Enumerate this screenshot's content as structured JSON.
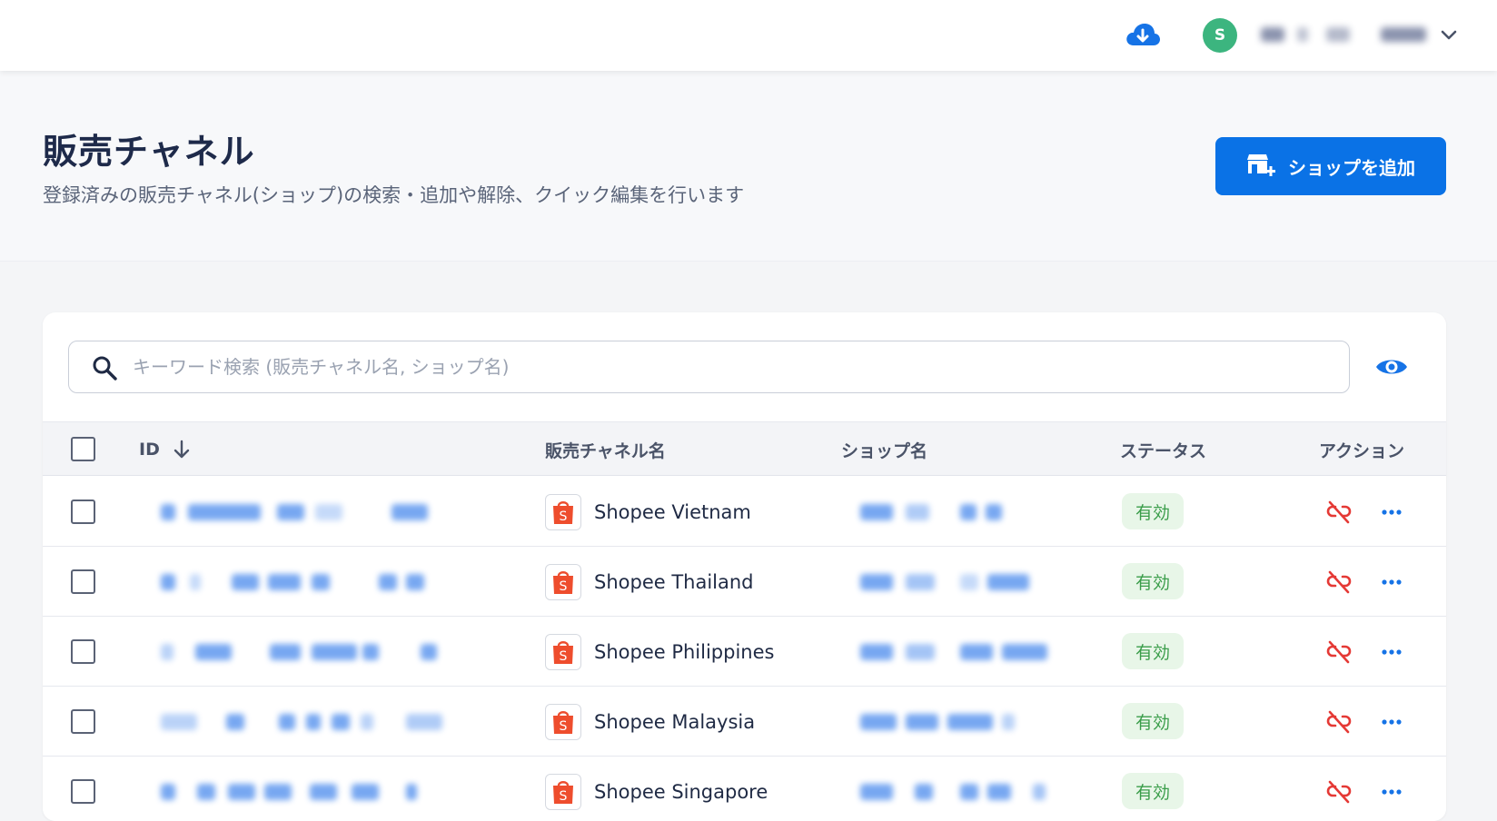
{
  "topbar": {
    "avatar_initial": "S"
  },
  "header": {
    "title": "販売チャネル",
    "subtitle": "登録済みの販売チャネル(ショップ)の検索・追加や解除、クイック編集を行います",
    "add_shop_label": "ショップを追加"
  },
  "search": {
    "placeholder": "キーワード検索 (販売チャネル名, ショップ名)"
  },
  "table": {
    "columns": {
      "id": "ID",
      "channel": "販売チャネル名",
      "shop": "ショップ名",
      "status": "ステータス",
      "action": "アクション"
    },
    "rows": [
      {
        "channel": "Shopee Vietnam",
        "status": "有効"
      },
      {
        "channel": "Shopee Thailand",
        "status": "有効"
      },
      {
        "channel": "Shopee Philippines",
        "status": "有効"
      },
      {
        "channel": "Shopee Malaysia",
        "status": "有効"
      },
      {
        "channel": "Shopee Singapore",
        "status": "有効"
      }
    ]
  },
  "colors": {
    "primary": "#0a72e6",
    "avatar": "#3cb57f",
    "status_bg": "#e8f6e8",
    "status_text": "#3a9d4a",
    "unlink": "#e53935",
    "shopee": "#ee4d2d"
  },
  "icons": {
    "cloud": "cloud-download-icon",
    "chevron": "chevron-down-icon",
    "store_add": "store-add-icon",
    "search": "search-icon",
    "eye": "eye-icon",
    "sort": "arrow-down-icon",
    "unlink": "link-off-icon",
    "more": "more-horizontal-icon",
    "shopee": "shopee-bag-icon"
  }
}
